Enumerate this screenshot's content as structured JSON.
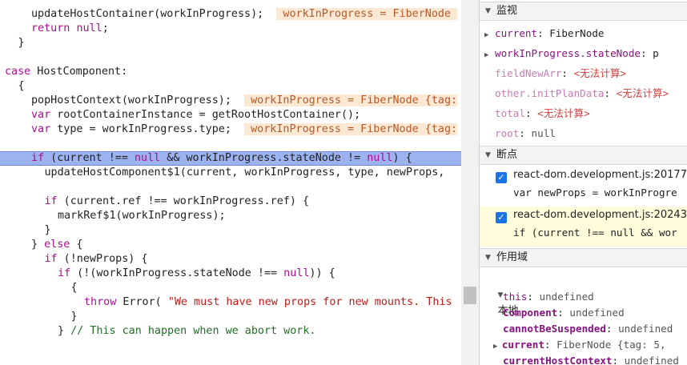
{
  "code_lines": [
    {
      "indent": "  ",
      "parts": [
        {
          "t": "updateHostContainer(workInProgress);  ",
          "c": ""
        },
        {
          "t": " workInProgress = FiberNode ",
          "c": "inl"
        }
      ]
    },
    {
      "indent": "  ",
      "parts": [
        {
          "t": "return",
          "c": "kw"
        },
        {
          "t": " ",
          "c": ""
        },
        {
          "t": "null",
          "c": "kw"
        },
        {
          "t": ";",
          "c": ""
        }
      ]
    },
    {
      "indent": " ",
      "parts": [
        {
          "t": "}",
          "c": ""
        }
      ]
    },
    {
      "indent": "",
      "parts": []
    },
    {
      "indent": "",
      "parts": [
        {
          "t": "case",
          "c": "kw"
        },
        {
          "t": " HostComponent:",
          "c": ""
        }
      ]
    },
    {
      "indent": " ",
      "parts": [
        {
          "t": "{",
          "c": ""
        }
      ]
    },
    {
      "indent": "  ",
      "parts": [
        {
          "t": "popHostContext(workInProgress);  ",
          "c": ""
        },
        {
          "t": " workInProgress = FiberNode {tag:",
          "c": "inl"
        }
      ]
    },
    {
      "indent": "  ",
      "parts": [
        {
          "t": "var",
          "c": "kw"
        },
        {
          "t": " rootContainerInstance = getRootHostContainer();",
          "c": ""
        }
      ]
    },
    {
      "indent": "  ",
      "parts": [
        {
          "t": "var",
          "c": "kw"
        },
        {
          "t": " type = workInProgress.type;  ",
          "c": ""
        },
        {
          "t": " workInProgress = FiberNode {tag:",
          "c": "inl"
        }
      ]
    },
    {
      "indent": "",
      "parts": []
    },
    {
      "indent": "  ",
      "hl": true,
      "parts": [
        {
          "t": "if",
          "c": "kw"
        },
        {
          "t": " (current !== ",
          "c": ""
        },
        {
          "t": "null",
          "c": "kw"
        },
        {
          "t": " && workInProgress.stateNode != ",
          "c": ""
        },
        {
          "t": "null",
          "c": "kw"
        },
        {
          "t": ") {",
          "c": ""
        }
      ]
    },
    {
      "indent": "   ",
      "parts": [
        {
          "t": "updateHostComponent$1(current, workInProgress, type, newProps,",
          "c": ""
        }
      ]
    },
    {
      "indent": "",
      "parts": []
    },
    {
      "indent": "   ",
      "parts": [
        {
          "t": "if",
          "c": "kw"
        },
        {
          "t": " (current.ref !== workInProgress.ref) {",
          "c": ""
        }
      ]
    },
    {
      "indent": "    ",
      "parts": [
        {
          "t": "markRef$1(workInProgress);",
          "c": ""
        }
      ]
    },
    {
      "indent": "   ",
      "parts": [
        {
          "t": "}",
          "c": ""
        }
      ]
    },
    {
      "indent": "  ",
      "parts": [
        {
          "t": "} ",
          "c": ""
        },
        {
          "t": "else",
          "c": "kw"
        },
        {
          "t": " {",
          "c": ""
        }
      ]
    },
    {
      "indent": "   ",
      "parts": [
        {
          "t": "if",
          "c": "kw"
        },
        {
          "t": " (!newProps) {",
          "c": ""
        }
      ]
    },
    {
      "indent": "    ",
      "parts": [
        {
          "t": "if",
          "c": "kw"
        },
        {
          "t": " (!(workInProgress.stateNode !== ",
          "c": ""
        },
        {
          "t": "null",
          "c": "kw"
        },
        {
          "t": ")) {",
          "c": ""
        }
      ]
    },
    {
      "indent": "     ",
      "parts": [
        {
          "t": "{",
          "c": ""
        }
      ]
    },
    {
      "indent": "      ",
      "parts": [
        {
          "t": "throw",
          "c": "kw"
        },
        {
          "t": " Error( ",
          "c": ""
        },
        {
          "t": "\"We must have new props for new mounts. This",
          "c": "str"
        }
      ]
    },
    {
      "indent": "     ",
      "parts": [
        {
          "t": "}",
          "c": ""
        }
      ]
    },
    {
      "indent": "    ",
      "parts": [
        {
          "t": "} ",
          "c": ""
        },
        {
          "t": "// This can happen when we abort work.",
          "c": "cm"
        }
      ]
    }
  ],
  "sidebar": {
    "watch": {
      "title": "监视",
      "items": [
        {
          "key": "current",
          "sep": ": ",
          "value": "FiberNode",
          "expand": true,
          "dim": false,
          "err": false
        },
        {
          "key": "workInProgress.stateNode",
          "sep": ": ",
          "value": "p",
          "expand": true,
          "dim": false,
          "err": false
        },
        {
          "key": "fieldNewArr",
          "sep": ": ",
          "value": "<无法计算>",
          "expand": false,
          "dim": true,
          "err": true
        },
        {
          "key": "other.initPlanData",
          "sep": ": ",
          "value": "<无法计算>",
          "expand": false,
          "dim": true,
          "err": true
        },
        {
          "key": "total",
          "sep": ": ",
          "value": "<无法计算>",
          "expand": false,
          "dim": true,
          "err": true
        },
        {
          "key": "root",
          "sep": ": ",
          "value": "null",
          "expand": false,
          "dim": true,
          "err": false
        }
      ]
    },
    "breakpoints": {
      "title": "断点",
      "items": [
        {
          "file": "react-dom.development.js:20177",
          "code": "var newProps = workInProgre",
          "active": false
        },
        {
          "file": "react-dom.development.js:20243",
          "code": "if (current !== null && wor",
          "active": true
        }
      ]
    },
    "scope": {
      "title": "作用域",
      "local_title": "本地",
      "items": [
        {
          "key": "this",
          "value": "undefined",
          "bold": false,
          "expand": false
        },
        {
          "key": "Component",
          "value": "undefined",
          "bold": true,
          "expand": false
        },
        {
          "key": "cannotBeSuspended",
          "value": "undefined",
          "bold": true,
          "expand": false
        },
        {
          "key": "current",
          "value": "FiberNode {tag: 5,",
          "bold": true,
          "expand": true
        },
        {
          "key": "currentHostContext",
          "value": "undefined",
          "bold": true,
          "expand": false
        }
      ]
    }
  }
}
